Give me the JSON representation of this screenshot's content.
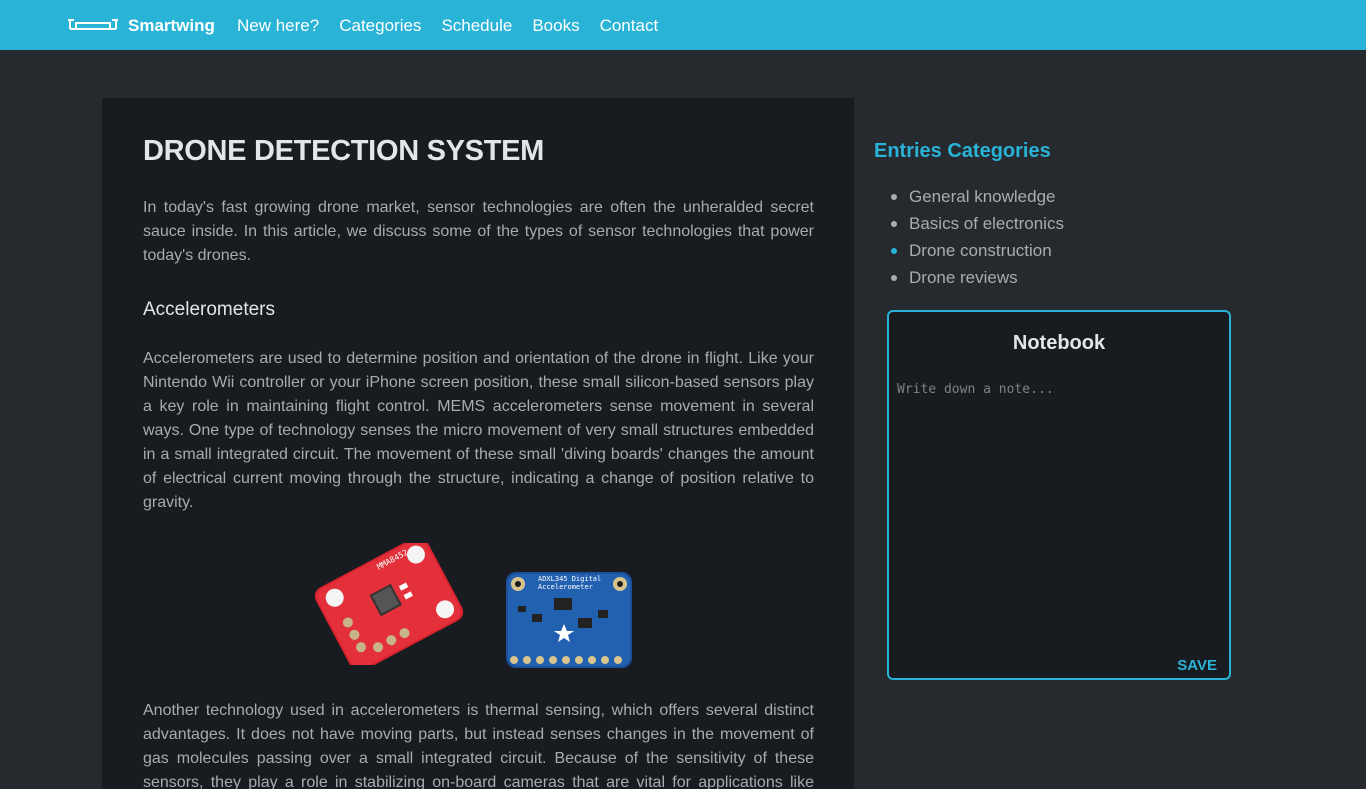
{
  "navbar": {
    "brand": "Smartwing",
    "links": [
      "New here?",
      "Categories",
      "Schedule",
      "Books",
      "Contact"
    ]
  },
  "article": {
    "title": "DRONE DETECTION SYSTEM",
    "intro": "In today's fast growing drone market, sensor technologies are often the unheralded secret sauce inside. In this article, we discuss some of the types of sensor technologies that power today's drones.",
    "section_heading": "Accelerometers",
    "para1": "Accelerometers are used to determine position and orientation of the drone in flight. Like your Nintendo Wii controller or your iPhone screen position, these small silicon-based sensors play a key role in maintaining flight control. MEMS accelerometers sense movement in several ways. One type of technology senses the micro movement of very small structures embedded in a small integrated circuit. The movement of these small 'diving boards' changes the amount of electrical current moving through the structure, indicating a change of position relative to gravity.",
    "para2": "Another technology used in accelerometers is thermal sensing, which offers several distinct advantages. It does not have moving parts, but instead senses changes in the movement of gas molecules passing over a small integrated circuit. Because of the sensitivity of these sensors, they play a role in stabilizing on-board cameras that are vital for applications like filmmaking.",
    "images": {
      "red_board_label": "MMA8452",
      "blue_board_label_1": "ADXL345 Digital",
      "blue_board_label_2": "Accelerometer"
    }
  },
  "sidebar": {
    "title": "Entries Categories",
    "categories": [
      "General knowledge",
      "Basics of electronics",
      "Drone construction",
      "Drone reviews"
    ]
  },
  "notebook": {
    "title": "Notebook",
    "placeholder": "Write down a note...",
    "save_label": "SAVE"
  },
  "colors": {
    "accent": "#29b3d6",
    "page_bg": "#262a2f",
    "panel_bg": "#181b1f"
  }
}
